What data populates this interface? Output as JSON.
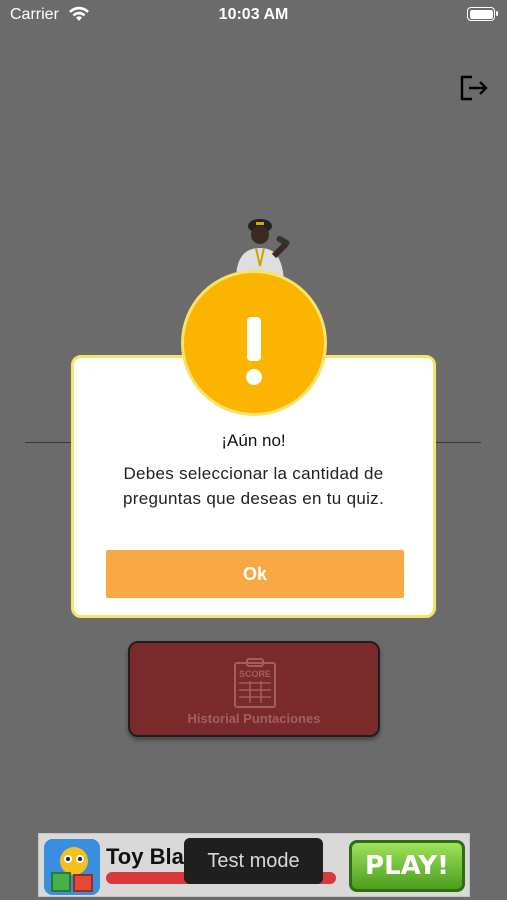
{
  "status_bar": {
    "carrier": "Carrier",
    "time": "10:03 AM"
  },
  "history_button": {
    "icon_text": "SCORE",
    "label": "Historial Puntaciones"
  },
  "ad": {
    "title": "Toy Bla",
    "play_label": "PLAY!"
  },
  "toast": {
    "text": "Test mode"
  },
  "alert": {
    "title": "¡Aún no!",
    "message": "Debes seleccionar la cantidad de preguntas que deseas en tu quiz.",
    "ok_label": "Ok"
  },
  "colors": {
    "background": "#6b6b6b",
    "alert_accent": "#fbb500",
    "alert_border": "#f4e46a",
    "ok_button": "#f9a843",
    "history_button": "#7a2a2a"
  },
  "icons": [
    "wifi-icon",
    "battery-icon",
    "logout-icon",
    "singer-image",
    "score-board-icon",
    "exclamation-icon",
    "ad-app-icon"
  ]
}
